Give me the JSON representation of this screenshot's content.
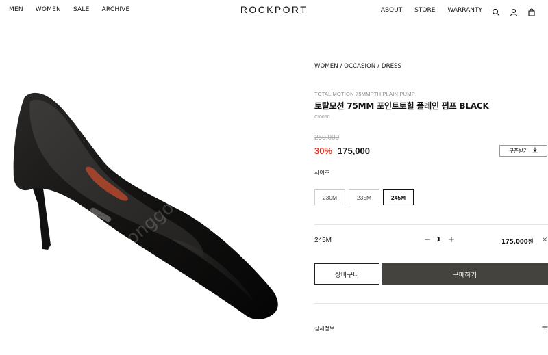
{
  "header": {
    "nav_left": [
      "MEN",
      "WOMEN",
      "SALE",
      "ARCHIVE"
    ],
    "logo": "ROCKPORT",
    "nav_right": [
      "ABOUT",
      "STORE",
      "WARRANTY"
    ],
    "icons": [
      "search-icon",
      "user-icon",
      "bag-icon"
    ]
  },
  "product": {
    "image": "black-leather-pointed-toe-pump",
    "breadcrumb": "WOMEN / OCCASION / DRESS",
    "subtitle": "TOTAL MOTION 75MMPTH PLAIN PUMP",
    "title": "토탈모션 75MM 포인트토힐 플레인 펌프 BLACK",
    "code": "CI0050",
    "original_price": "250,000",
    "discount": "30%",
    "price": "175,000",
    "coupon_label": "쿠폰받기",
    "size_label": "사이즈",
    "sizes": [
      "230M",
      "235M",
      "245M"
    ],
    "selected_size": "245M"
  },
  "selection": {
    "size": "245M",
    "minus": "−",
    "quantity": "1",
    "plus": "+",
    "line_price": "175,000원",
    "remove": "×"
  },
  "actions": {
    "cart_label": "장바구니",
    "buy_label": "구매하기"
  },
  "details": {
    "label": "상세정보",
    "expand": "+"
  },
  "colors": {
    "discount": "#e0301e",
    "buy_button": "#44433d"
  }
}
